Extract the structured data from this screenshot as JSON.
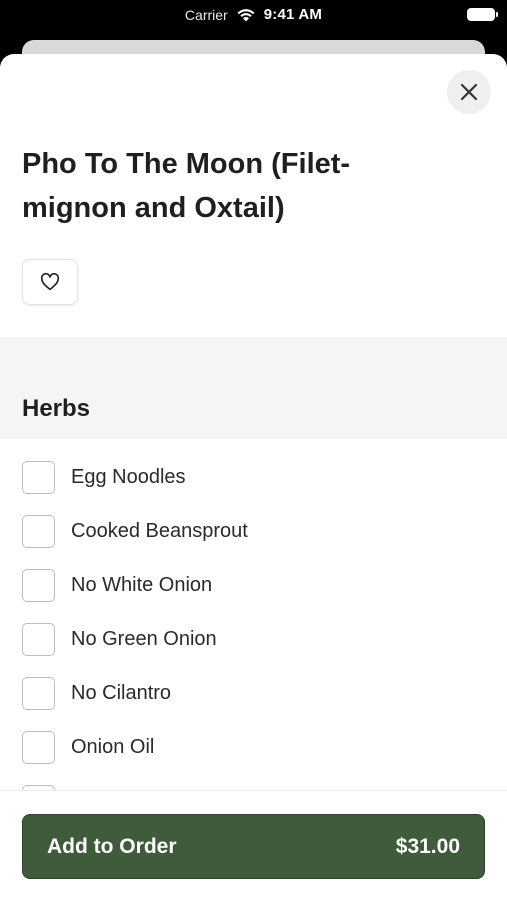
{
  "status_bar": {
    "carrier": "Carrier",
    "time": "9:41 AM"
  },
  "item": {
    "title": "Pho To The Moon (Filet-mignon and Oxtail)"
  },
  "section": {
    "title": "Herbs"
  },
  "options": [
    {
      "label": "Egg Noodles",
      "checked": false
    },
    {
      "label": "Cooked Beansprout",
      "checked": false
    },
    {
      "label": "No White Onion",
      "checked": false
    },
    {
      "label": "No Green Onion",
      "checked": false
    },
    {
      "label": "No Cilantro",
      "checked": false
    },
    {
      "label": "Onion Oil",
      "checked": false
    }
  ],
  "footer": {
    "button_label": "Add to Order",
    "price": "$31.00"
  },
  "colors": {
    "primary": "#3f5b3b",
    "section_bg": "#f5f5f5"
  }
}
